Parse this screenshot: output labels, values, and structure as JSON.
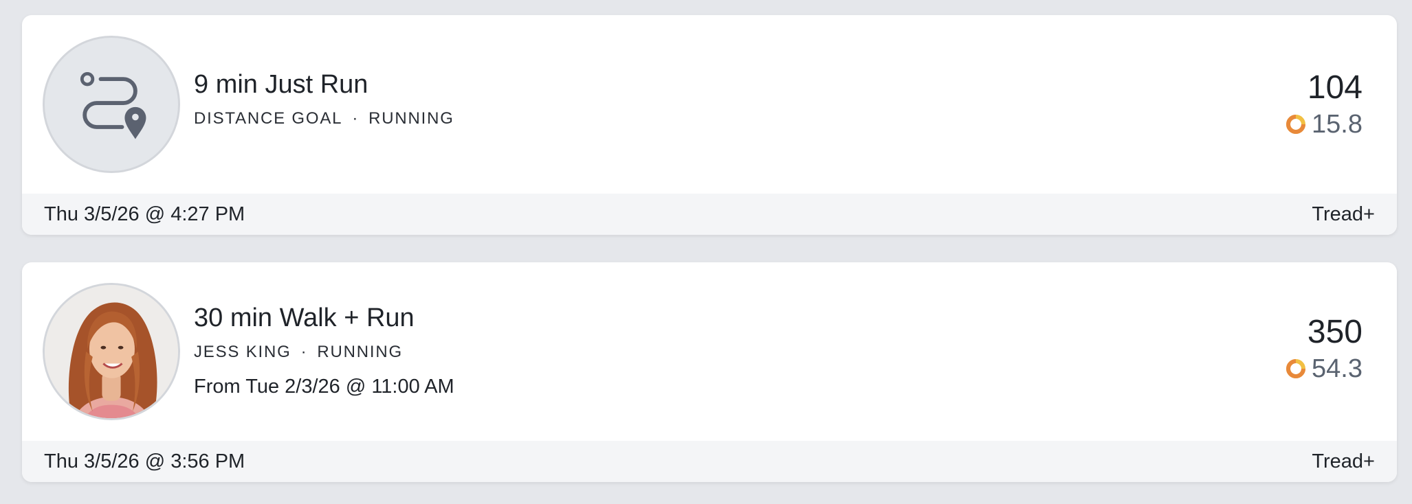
{
  "workouts": [
    {
      "title": "9 min Just Run",
      "category": "DISTANCE GOAL",
      "separator": "·",
      "discipline": "RUNNING",
      "output": "104",
      "points": "15.8",
      "date": "Thu 3/5/26 @ 4:27 PM",
      "device": "Tread+",
      "avatar_icon": "route-pin-icon"
    },
    {
      "title": "30 min Walk + Run",
      "instructor": "JESS KING",
      "separator": "·",
      "discipline": "RUNNING",
      "from": "From Tue 2/3/26 @ 11:00 AM",
      "output": "350",
      "points": "54.3",
      "date": "Thu 3/5/26 @ 3:56 PM",
      "device": "Tread+",
      "avatar_icon": "instructor-photo"
    }
  ],
  "colors": {
    "ring_orange": "#e8893a",
    "ring_yellow": "#f2c043",
    "footer_bg": "#f4f5f7",
    "page_bg": "#e5e7eb"
  }
}
